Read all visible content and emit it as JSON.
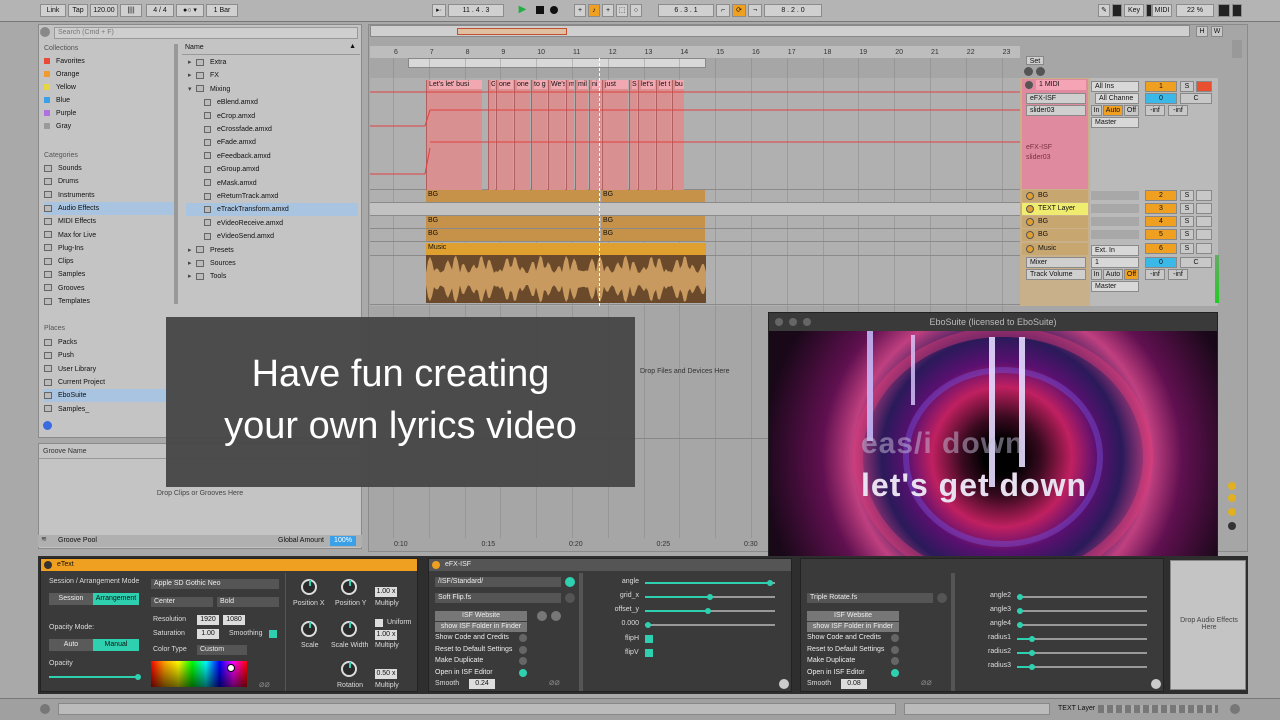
{
  "transport": {
    "link": "Link",
    "tap": "Tap",
    "tempo": "120.00",
    "meter": "4 / 4",
    "quant": "1 Bar",
    "position": "11 .  4 .  3",
    "loop_start": "6 .  3 .  1",
    "loop_len": "8 .  2 .  0",
    "key": "Key",
    "midi": "MIDI",
    "cpu": "22 %"
  },
  "browser": {
    "search_placeholder": "Search (Cmd + F)",
    "collections_header": "Collections",
    "collections": [
      {
        "label": "Favorites",
        "color": "#e84a3a"
      },
      {
        "label": "Orange",
        "color": "#f09a30"
      },
      {
        "label": "Yellow",
        "color": "#e8d640"
      },
      {
        "label": "Blue",
        "color": "#3aa0e8"
      },
      {
        "label": "Purple",
        "color": "#b070e0"
      },
      {
        "label": "Gray",
        "color": "#9a9a9a"
      }
    ],
    "categories_header": "Categories",
    "categories": [
      "Sounds",
      "Drums",
      "Instruments",
      "Audio Effects",
      "MIDI Effects",
      "Max for Live",
      "Plug-Ins",
      "Clips",
      "Samples",
      "Grooves",
      "Templates"
    ],
    "places_header": "Places",
    "places": [
      "Packs",
      "Push",
      "User Library",
      "Current Project",
      "EboSuite",
      "Samples_"
    ],
    "name_header": "Name",
    "files": [
      {
        "label": "Extra",
        "type": "folder-closed"
      },
      {
        "label": "FX",
        "type": "folder-closed"
      },
      {
        "label": "Mixing",
        "type": "folder-open"
      },
      {
        "label": "eBlend.amxd",
        "type": "file"
      },
      {
        "label": "eCrop.amxd",
        "type": "file"
      },
      {
        "label": "eCrossfade.amxd",
        "type": "file"
      },
      {
        "label": "eFade.amxd",
        "type": "file"
      },
      {
        "label": "eFeedback.amxd",
        "type": "file"
      },
      {
        "label": "eGroup.amxd",
        "type": "file"
      },
      {
        "label": "eMask.amxd",
        "type": "file"
      },
      {
        "label": "eReturnTrack.amxd",
        "type": "file"
      },
      {
        "label": "eTrackTransform.amxd",
        "type": "file"
      },
      {
        "label": "eVideoReceive.amxd",
        "type": "file"
      },
      {
        "label": "eVideoSend.amxd",
        "type": "file"
      },
      {
        "label": "Presets",
        "type": "folder-closed"
      },
      {
        "label": "Sources",
        "type": "folder-closed"
      },
      {
        "label": "Tools",
        "type": "folder-closed"
      }
    ],
    "groove_header": "Groove Name",
    "groove_drop": "Drop Clips or Grooves Here",
    "groove_pool": "Groove Pool",
    "global_amount_label": "Global Amount",
    "global_amount": "100%"
  },
  "arrangement": {
    "ruler": [
      "6",
      "7",
      "8",
      "9",
      "10",
      "11",
      "12",
      "13",
      "14",
      "15",
      "16",
      "17",
      "18",
      "19",
      "20",
      "21",
      "22",
      "23"
    ],
    "time_ruler": [
      "0:10",
      "0:15",
      "0:20",
      "0:25",
      "0:30"
    ],
    "lyric_clips": [
      "Let's let' busi",
      "Gi",
      "one",
      "one",
      "to g",
      "We's",
      "m",
      "mil",
      "ni",
      "just",
      "S",
      "let's",
      "let t",
      "bu"
    ],
    "bg_clip": "BG",
    "music_clip": "Music",
    "drop_files": "Drop Files and Devices Here"
  },
  "tracks": [
    {
      "name": "1 MIDI",
      "num": "1",
      "color": "#f08a9a"
    },
    {
      "name": "BG",
      "num": "2",
      "color": "#d09a50"
    },
    {
      "name": "TEXT Layer",
      "num": "3",
      "color": "#e8e040"
    },
    {
      "name": "BG",
      "num": "4",
      "color": "#d09a50"
    },
    {
      "name": "BG",
      "num": "5",
      "color": "#d09a50"
    },
    {
      "name": "Music",
      "num": "6",
      "color": "#e8a830"
    }
  ],
  "midi_track": {
    "input": "All Ins",
    "channel": "All Channe",
    "monitor_in": "In",
    "monitor_auto": "Auto",
    "monitor_off": "Off",
    "out": "Master",
    "device1": "eFX-ISF",
    "param1": "slider03",
    "dev_label1": "eFX-ISF",
    "dev_label2": "slider03",
    "vol": "0",
    "pan": "C",
    "peak_l": "-inf",
    "peak_r": "-inf",
    "set_label": "Set"
  },
  "music_track": {
    "input": "Ext. In",
    "chan": "1",
    "mixer": "Mixer",
    "track_volume": "Track Volume",
    "out": "Master",
    "vol": "0",
    "pan": "C",
    "peak_l": "-inf",
    "peak_r": "-inf"
  },
  "overlay": {
    "line1": "Have fun creating",
    "line2": "your own lyrics video"
  },
  "video_window": {
    "title": "EboSuite (licensed to EboSuite)",
    "lyric_main": "let's get down",
    "lyric_ghost": "eas/i  down"
  },
  "etext": {
    "title": "eText",
    "mode_label": "Session / Arrangement Mode",
    "session": "Session",
    "arrangement": "Arrangement",
    "opacity_mode": "Opacity Mode:",
    "auto": "Auto",
    "manual": "Manual",
    "opacity": "Opacity",
    "font": "Apple SD Gothic Neo",
    "align": "Center",
    "weight": "Bold",
    "resolution_label": "Resolution",
    "res_w": "1920",
    "res_h": "1080",
    "saturation_label": "Saturation",
    "saturation": "1.00",
    "smoothing": "Smoothing",
    "color_type_label": "Color Type",
    "color_type": "Custom",
    "pos_x": "Position X",
    "pos_y": "Position Y",
    "multiply": "Multiply",
    "mult_val": "1.00 x",
    "scale": "Scale",
    "scale_width": "Scale Width",
    "uniform": "Uniform",
    "mult_val2": "1.00 x",
    "rotation": "Rotation",
    "mult_val3": "0.50 x"
  },
  "isf1": {
    "title": "eFX-ISF",
    "path": "/ISF/Standard/",
    "shader": "Soft Flip.fs",
    "website": "ISF Website",
    "show_folder": "show ISF Folder in Finder",
    "menu": [
      "Show Code and Credits",
      "Reset to Default Settings",
      "Make Duplicate",
      "Open in ISF Editor"
    ],
    "smooth_label": "Smooth",
    "smooth": "0.24",
    "params": [
      {
        "label": "angle",
        "value": 0.98
      },
      {
        "label": "grid_x",
        "value": 0.5
      },
      {
        "label": "offset_y",
        "value": 0.48
      },
      {
        "label": "0.000",
        "value": 0.0
      }
    ],
    "flip_h": "flipH",
    "flip_v": "flipV"
  },
  "isf2": {
    "shader": "Triple Rotate.fs",
    "website": "ISF Website",
    "show_folder": "show ISF Folder in Finder",
    "menu": [
      "Show Code and Credits",
      "Reset to Default Settings",
      "Make Duplicate",
      "Open in ISF Editor"
    ],
    "smooth_label": "Smooth",
    "smooth": "0.08",
    "params": [
      {
        "label": "angle2",
        "value": 0.0
      },
      {
        "label": "angle3",
        "value": 0.0
      },
      {
        "label": "angle4",
        "value": 0.0
      },
      {
        "label": "radius1",
        "value": 0.1
      },
      {
        "label": "radius2",
        "value": 0.1
      },
      {
        "label": "radius3",
        "value": 0.1
      }
    ]
  },
  "drop_audio": "Drop Audio Effects Here",
  "status_track": "TEXT Layer"
}
